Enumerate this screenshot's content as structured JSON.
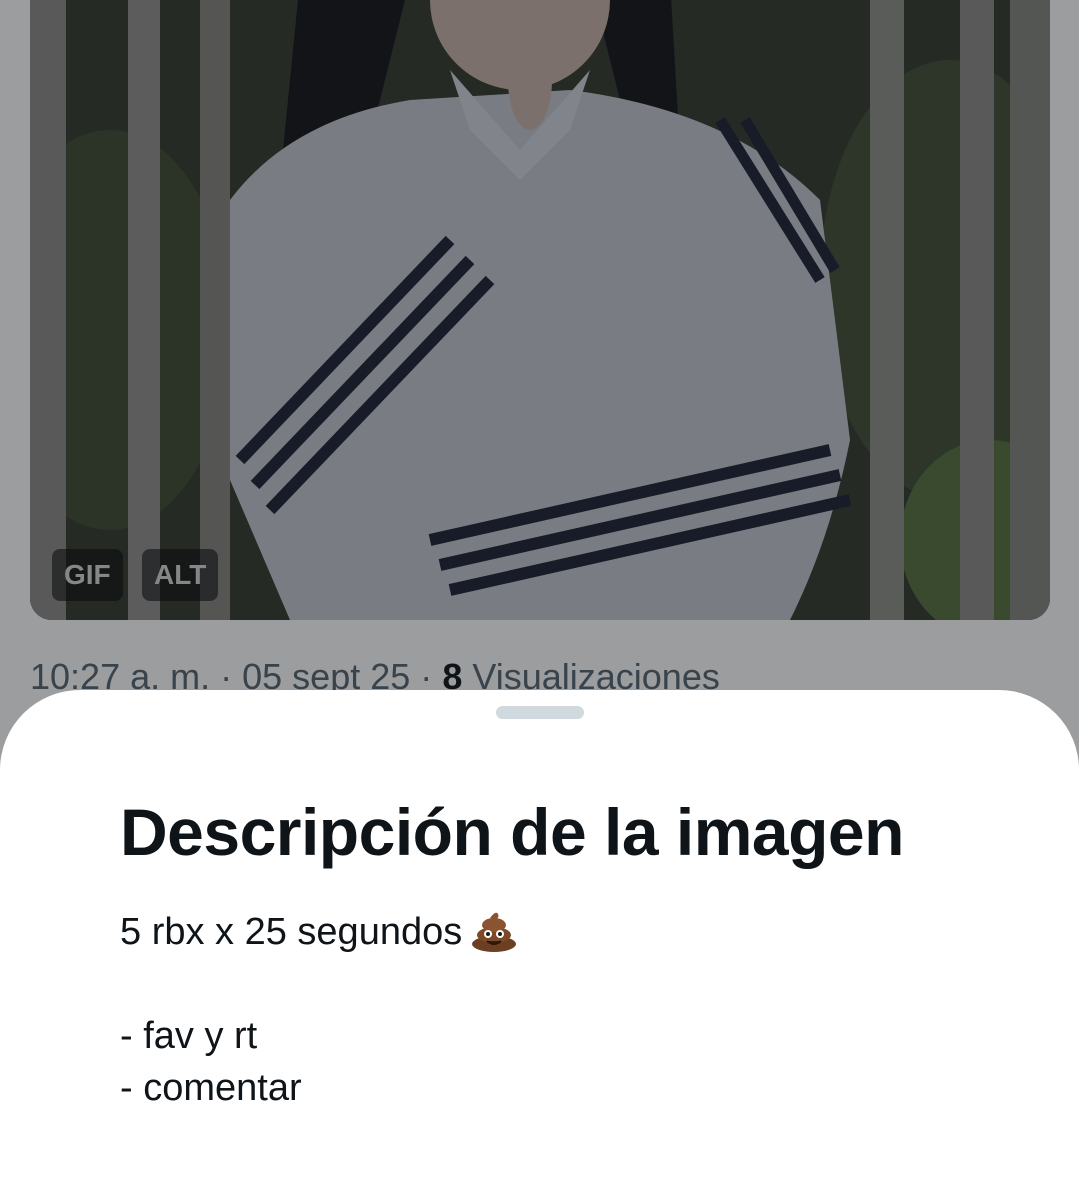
{
  "tweet": {
    "media": {
      "badges": [
        "GIF",
        "ALT"
      ]
    },
    "meta": {
      "time": "10:27 a. m.",
      "separator": "·",
      "date": "05 sept 25",
      "views_count": "8",
      "views_label": "Visualizaciones"
    }
  },
  "sheet": {
    "title": "Descripción de la imagen",
    "description_lines": [
      "5 rbx x 25 segundos",
      "",
      "- fav y rt",
      "- comentar"
    ],
    "emoji_icon": "pile-of-poo-icon"
  },
  "colors": {
    "text_primary": "#0f1419",
    "text_secondary": "#536471",
    "handle": "#cfd9de",
    "overlay": "rgba(20,22,26,0.42)"
  }
}
